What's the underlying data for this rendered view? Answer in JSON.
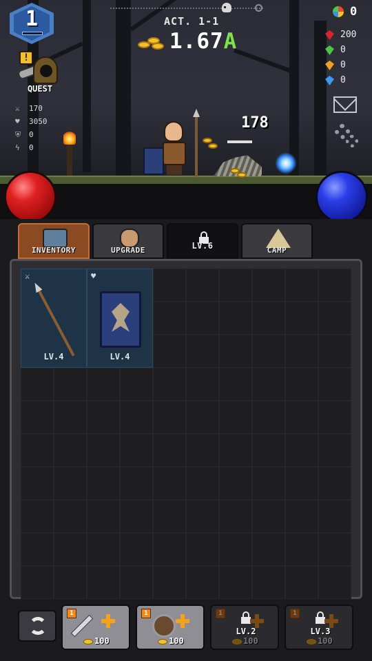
{
  "hud": {
    "player_level": "1",
    "act_label": "ACT. 1-1",
    "gold_value": "1.67",
    "gold_unit": "A",
    "orb_count": "0",
    "quest_label": "QUEST",
    "quest_alert": "!"
  },
  "gems": [
    {
      "name": "red-gem",
      "color": "#d8252a",
      "value": "200"
    },
    {
      "name": "green-gem",
      "color": "#4cc448",
      "value": "0"
    },
    {
      "name": "orange-gem",
      "color": "#f0a020",
      "value": "0"
    },
    {
      "name": "blue-gem",
      "color": "#3a9af0",
      "value": "0"
    }
  ],
  "stats": [
    {
      "icon": "sword-icon",
      "glyph": "⚔",
      "value": "170"
    },
    {
      "icon": "heart-icon",
      "glyph": "♥",
      "value": "3050"
    },
    {
      "icon": "shield-icon",
      "glyph": "⛨",
      "value": "0"
    },
    {
      "icon": "bolt-icon",
      "glyph": "ϟ",
      "value": "0"
    }
  ],
  "battle": {
    "damage_number": "178"
  },
  "tabs": [
    {
      "id": "inventory",
      "label": "INVENTORY",
      "active": true,
      "locked": false
    },
    {
      "id": "upgrade",
      "label": "UPGRADE",
      "active": false,
      "locked": false
    },
    {
      "id": "locked",
      "label": "LV.6",
      "active": false,
      "locked": true
    },
    {
      "id": "camp",
      "label": "CAMP",
      "active": false,
      "locked": false,
      "alert": "+"
    }
  ],
  "inventory": {
    "items": [
      {
        "name": "spear",
        "slot_icon": "sword-icon",
        "slot_glyph": "⚔",
        "level": "LV.4"
      },
      {
        "name": "shield",
        "slot_icon": "heart-icon",
        "slot_glyph": "♥",
        "level": "LV.4"
      }
    ]
  },
  "craft_buttons": [
    {
      "id": "weapon",
      "badge": "1",
      "cost": "100",
      "locked": false,
      "level": ""
    },
    {
      "id": "shield",
      "badge": "1",
      "cost": "100",
      "locked": false,
      "level": ""
    },
    {
      "id": "slot3",
      "badge": "1",
      "cost": "100",
      "locked": true,
      "level": "LV.2"
    },
    {
      "id": "slot4",
      "badge": "1",
      "cost": "100",
      "locked": true,
      "level": "LV.3"
    }
  ],
  "colors": {
    "active_tab": "#8b4a22",
    "gold": "#f2c12e",
    "gold_unit": "#7fe04a",
    "hp_orb": "#e02020",
    "mp_orb": "#2a3ee8",
    "item_slot": "#1f3346"
  }
}
